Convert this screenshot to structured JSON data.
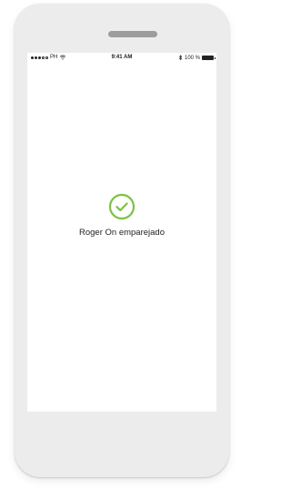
{
  "status_bar": {
    "carrier": "PH",
    "time": "9:41 AM",
    "battery_percent": "100 %",
    "signal_bars_filled": 3,
    "signal_bars_total": 5
  },
  "icons": {
    "success": "check-circle-icon",
    "wifi": "wifi-icon",
    "bluetooth": "bluetooth-icon",
    "battery": "battery-icon"
  },
  "colors": {
    "success_green": "#7cc242",
    "text": "#1f1f1f",
    "phone_frame": "#ececec"
  },
  "main": {
    "message": "Roger On emparejado"
  }
}
